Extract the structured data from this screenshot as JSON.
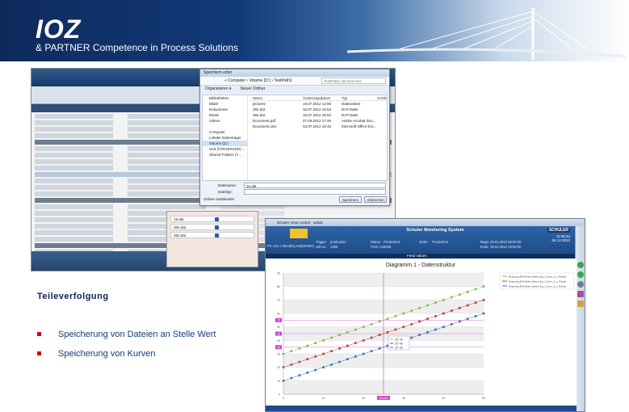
{
  "header": {
    "logo_mark": "IOZ",
    "tagline": "& PARTNER  Competence in Process Solutions"
  },
  "save_dialog": {
    "title": "Speichern unter",
    "address": "« Computer › Volume (D:) › TestPath1",
    "search_placeholder": "TestPath1 durchsuchen",
    "toolbar": [
      "Organisieren ▾",
      "Neuer Ordner"
    ],
    "nav": [
      "Bibliotheken",
      "Bilder",
      "Dokumente",
      "Musik",
      "Videos",
      "",
      "Computer",
      "Lokaler Datenträger",
      "Volume (D:)",
      "SLB (\\\\TRSERVER) ...",
      "Shared Folders (\\\\ ..."
    ],
    "columns": [
      "Name",
      "Änderungsdatum",
      "Typ",
      "Größe"
    ],
    "files": [
      {
        "name": "pictures",
        "date": "19.07.2012 14:59",
        "type": "Dateiordner",
        "size": ""
      },
      {
        "name": "384.dat",
        "date": "16.07.2012 16:53",
        "type": "DAT-Datei",
        "size": ""
      },
      {
        "name": "392.dat",
        "date": "16.07.2012 16:53",
        "type": "DAT-Datei",
        "size": ""
      },
      {
        "name": "Document.pdf",
        "date": "27.06.2012 17:49",
        "type": "Adobe Acrobat Doc...",
        "size": ""
      },
      {
        "name": "Document.xlsx",
        "date": "03.07.2012 15:46",
        "type": "Microsoft Office Exc...",
        "size": ""
      }
    ],
    "filename_label": "Dateiname:",
    "filename_value": "15.dat",
    "filetype_label": "Dateityp:",
    "filetype_value": "",
    "hide_folders": "Ordner ausblenden",
    "save_button": "Speichern",
    "cancel_button": "Abbrechen"
  },
  "values_panel": {
    "rows": [
      "15.dat",
      "384.dat",
      "392.dat"
    ]
  },
  "slide": {
    "heading": "Teileverfolgung",
    "bullets": [
      "Speicherung von Dateien an Stelle Wert",
      "Speicherung von Kurven"
    ]
  },
  "monitor": {
    "window_title": "Schuler View control - sdsd1",
    "system_title": "Schuler Monitoring System",
    "brand": "SCHULER",
    "time": "11:58:34",
    "date": "04.12.2012",
    "fields": {
      "line": "PS Line 1  Bending Sub(ENDH)",
      "trigger_label": "Trigger",
      "trigger_value": "production",
      "job_label": "Job no.",
      "job_value": "1286",
      "status_label": "Status",
      "status_value": "Production",
      "prod_label": "Prod. no.",
      "prod_value": "5936",
      "order_label": "Order",
      "order_value": "Production",
      "begin_label": "Begin",
      "begin_value": "29.01.2012 06:00:00",
      "end_label": "Ende",
      "end_value": "29.01.2012 15:00:00"
    },
    "band_label": "Feed values",
    "chart_title": "Diagramm 1 - Datenstruktur"
  },
  "chart_data": {
    "type": "line",
    "title": "Diagramm 1 - Datenstruktur",
    "x": [
      0,
      2,
      4,
      6,
      8,
      10,
      12,
      14,
      16,
      18,
      20,
      22,
      24,
      26,
      28,
      30,
      32,
      34,
      36,
      38,
      40,
      42,
      44,
      46,
      48,
      50
    ],
    "series": [
      {
        "name": "Reporting.B.Portfolio.Values.Sig_1_Kurv_1_y_Punkte",
        "color": "#8fb84c",
        "values": [
          30,
          32,
          34,
          36,
          38,
          40,
          42,
          44,
          46,
          48,
          50,
          52,
          54,
          56,
          58,
          60,
          62,
          64,
          66,
          68,
          70,
          72,
          74,
          76,
          78,
          80
        ]
      },
      {
        "name": "Reporting.B.Portfolio.Values.Sig_1_Kurv_2_y_Punkte",
        "color": "#c23b3b",
        "values": [
          20,
          22,
          24,
          26,
          28,
          30,
          32,
          34,
          36,
          38,
          40,
          42,
          44,
          46,
          48,
          50,
          52,
          54,
          56,
          58,
          60,
          62,
          64,
          66,
          68,
          70
        ]
      },
      {
        "name": "Reporting.B.Portfolio.Values.Sig_1_Kurv_3_y_Punkte",
        "color": "#3f6fc4",
        "values": [
          10,
          12,
          14,
          16,
          18,
          20,
          22,
          24,
          26,
          28,
          30,
          32,
          34,
          36,
          38,
          40,
          42,
          44,
          46,
          48,
          50,
          52,
          54,
          56,
          58,
          60
        ]
      }
    ],
    "xlim": [
      0,
      50
    ],
    "ylim": [
      0,
      90
    ],
    "y_ticks": [
      0,
      10,
      20,
      30,
      40,
      50,
      60,
      70,
      80,
      90
    ],
    "x_ticks": [
      0,
      10,
      20,
      30,
      40,
      50
    ],
    "cursor_x": 25,
    "cursor_label": "25,0000",
    "marker_labels": [
      "75",
      "40",
      "25"
    ],
    "tooltip": [
      "25 / 35",
      "25 / 45",
      "25 / 55"
    ],
    "grid": true,
    "legend": "top-right"
  }
}
